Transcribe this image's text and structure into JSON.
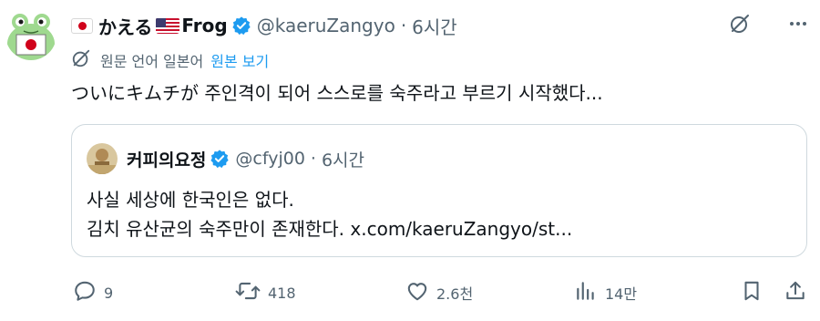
{
  "author": {
    "display_name": "かえる",
    "display_name_suffix": "Frog",
    "handle": "@kaeruZangyo",
    "separator": "·",
    "time": "6시간",
    "verified": true
  },
  "translate": {
    "label": "원문 언어 일본어",
    "link": "원본 보기"
  },
  "tweet_text": "ついにキムチが 주인격이 되어 스스로를 숙주라고 부르기 시작했다...",
  "quote": {
    "display_name": "커피의요정",
    "handle": "@cfyj00",
    "separator": "·",
    "time": "6시간",
    "verified": true,
    "line1": "사실 세상에 한국인은 없다.",
    "line2": "김치 유산균의 숙주만이 존재한다. x.com/kaeruZangyo/st..."
  },
  "actions": {
    "replies": "9",
    "retweets": "418",
    "likes": "2.6천",
    "views": "14만"
  },
  "colors": {
    "text": "#0f1419",
    "secondary": "#536471",
    "link": "#1d9bf0",
    "verified": "#1d9bf0",
    "border": "#cfd9de"
  },
  "icons": [
    "frog-avatar",
    "flag-jp-icon",
    "flag-us-icon",
    "verified-icon",
    "grok-icon",
    "more-icon",
    "translate-icon",
    "reply-icon",
    "retweet-icon",
    "like-icon",
    "views-icon",
    "bookmark-icon",
    "share-icon"
  ]
}
